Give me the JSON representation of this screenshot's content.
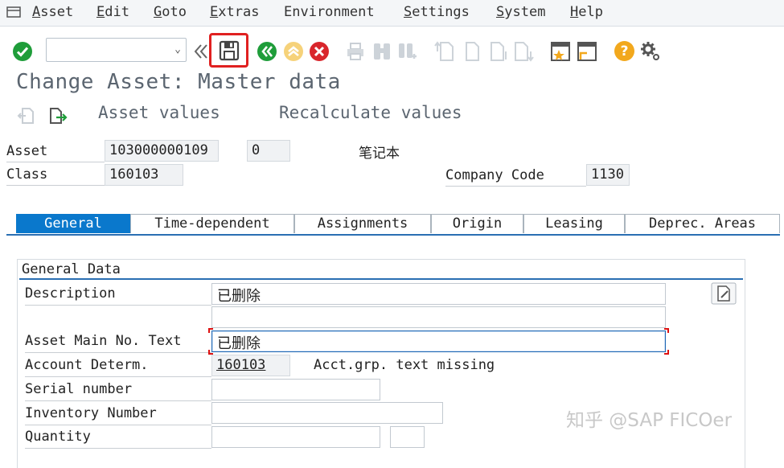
{
  "menu": [
    {
      "first": "A",
      "rest": "sset"
    },
    {
      "first": "E",
      "rest": "dit"
    },
    {
      "first": "G",
      "rest": "oto"
    },
    {
      "first": "E",
      "rest": "xtras"
    },
    {
      "first": "",
      "rest": "Environment"
    },
    {
      "first": "S",
      "rest": "ettings"
    },
    {
      "first": "S",
      "rest": "ystem"
    },
    {
      "first": "H",
      "rest": "elp"
    }
  ],
  "toolbar": {
    "command_value": "",
    "icons": [
      "enter-icon",
      "back-icon",
      "save-icon",
      "back-green-icon",
      "exit-icon",
      "cancel-icon",
      "print-icon",
      "find-icon",
      "find-next-icon",
      "first-page-icon",
      "previous-page-icon",
      "next-page-icon",
      "last-page-icon",
      "create-session-icon",
      "shortcut-icon",
      "help-icon",
      "customize-layout-icon"
    ]
  },
  "page_title": "Change Asset:  Master data",
  "app_toolbar": {
    "asset_values": "Asset values",
    "recalculate_values": "Recalculate values"
  },
  "header": {
    "asset_label": "Asset",
    "asset_number": "103000000109",
    "asset_subnumber": "0",
    "asset_name": "笔记本",
    "class_label": "Class",
    "class_value": "160103",
    "company_code_label": "Company Code",
    "company_code_value": "1130"
  },
  "tabs": [
    {
      "label": "General",
      "active": true
    },
    {
      "label": "Time-dependent",
      "active": false
    },
    {
      "label": "Assignments",
      "active": false
    },
    {
      "label": "Origin",
      "active": false
    },
    {
      "label": "Leasing",
      "active": false
    },
    {
      "label": "Deprec. Areas",
      "active": false
    }
  ],
  "general_data": {
    "title": "General Data",
    "description_label": "Description",
    "description_value": "已删除",
    "description_line2": "",
    "main_no_text_label": "Asset Main No. Text",
    "main_no_text_value": "已删除",
    "account_determ_label": "Account Determ.",
    "account_determ_value": "160103",
    "account_determ_text": "Acct.grp. text missing",
    "serial_number_label": "Serial number",
    "serial_number_value": "",
    "inventory_number_label": "Inventory Number",
    "inventory_number_value": "",
    "quantity_label": "Quantity",
    "quantity_value": "",
    "quantity_unit": ""
  },
  "watermark": "知乎 @SAP FICOer",
  "colors": {
    "tab_active": "#0a78cc",
    "save_highlight": "#e02020",
    "enter_green": "#1f9d3a",
    "help_orange": "#f2a81d"
  }
}
